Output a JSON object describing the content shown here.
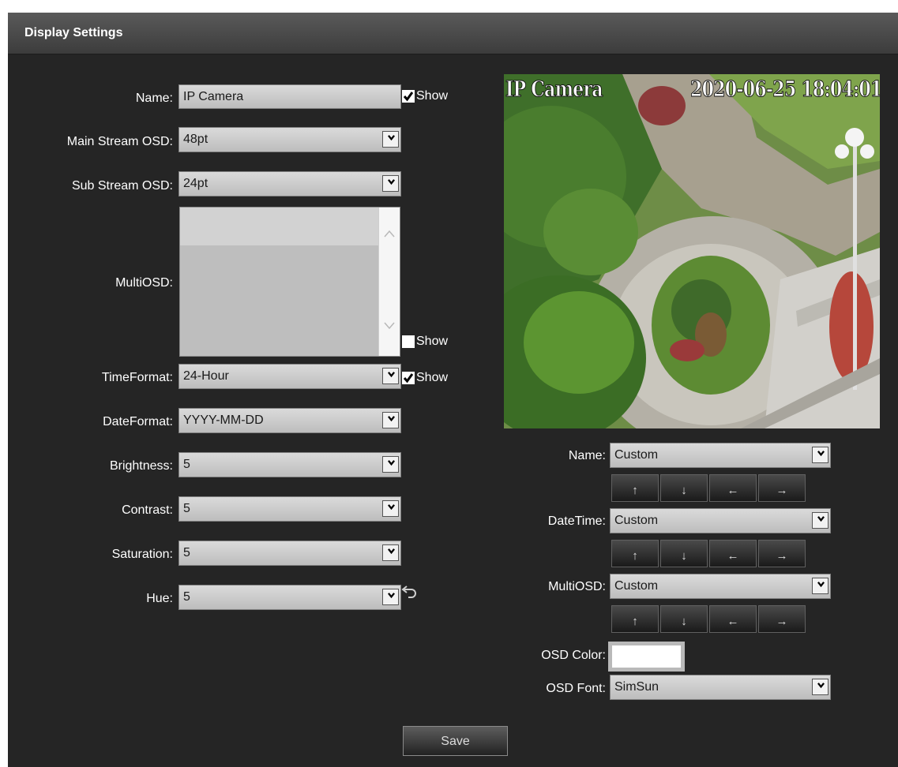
{
  "panel": {
    "title": "Display Settings"
  },
  "left_form": {
    "name": {
      "label": "Name:",
      "value": "IP Camera",
      "show_label": "Show",
      "show_checked": true
    },
    "main_stream_osd": {
      "label": "Main Stream OSD:",
      "value": "48pt"
    },
    "sub_stream_osd": {
      "label": "Sub Stream OSD:",
      "value": "24pt"
    },
    "multi_osd": {
      "label": "MultiOSD:",
      "show_label": "Show",
      "show_checked": false
    },
    "time_format": {
      "label": "TimeFormat:",
      "value": "24-Hour",
      "show_label": "Show",
      "show_checked": true
    },
    "date_format": {
      "label": "DateFormat:",
      "value": "YYYY-MM-DD"
    },
    "brightness": {
      "label": "Brightness:",
      "value": "5"
    },
    "contrast": {
      "label": "Contrast:",
      "value": "5"
    },
    "saturation": {
      "label": "Saturation:",
      "value": "5"
    },
    "hue": {
      "label": "Hue:",
      "value": "5"
    }
  },
  "preview": {
    "osd_name": "IP Camera",
    "osd_datetime": "2020-06-25 18:04:01"
  },
  "right_form": {
    "name_pos": {
      "label": "Name:",
      "value": "Custom"
    },
    "datetime_pos": {
      "label": "DateTime:",
      "value": "Custom"
    },
    "multiosd_pos": {
      "label": "MultiOSD:",
      "value": "Custom"
    },
    "arrows": {
      "up": "↑",
      "down": "↓",
      "left": "←",
      "right": "→"
    },
    "osd_color": {
      "label": "OSD Color:",
      "value": "#ffffff"
    },
    "osd_font": {
      "label": "OSD Font:",
      "value": "SimSun"
    }
  },
  "save_label": "Save",
  "icons": {
    "dropdown": "chevron-down-icon",
    "checkbox": "checkmark-icon",
    "restore": "undo-icon",
    "scroll_up": "chevron-up-icon",
    "scroll_down": "chevron-down-icon"
  }
}
